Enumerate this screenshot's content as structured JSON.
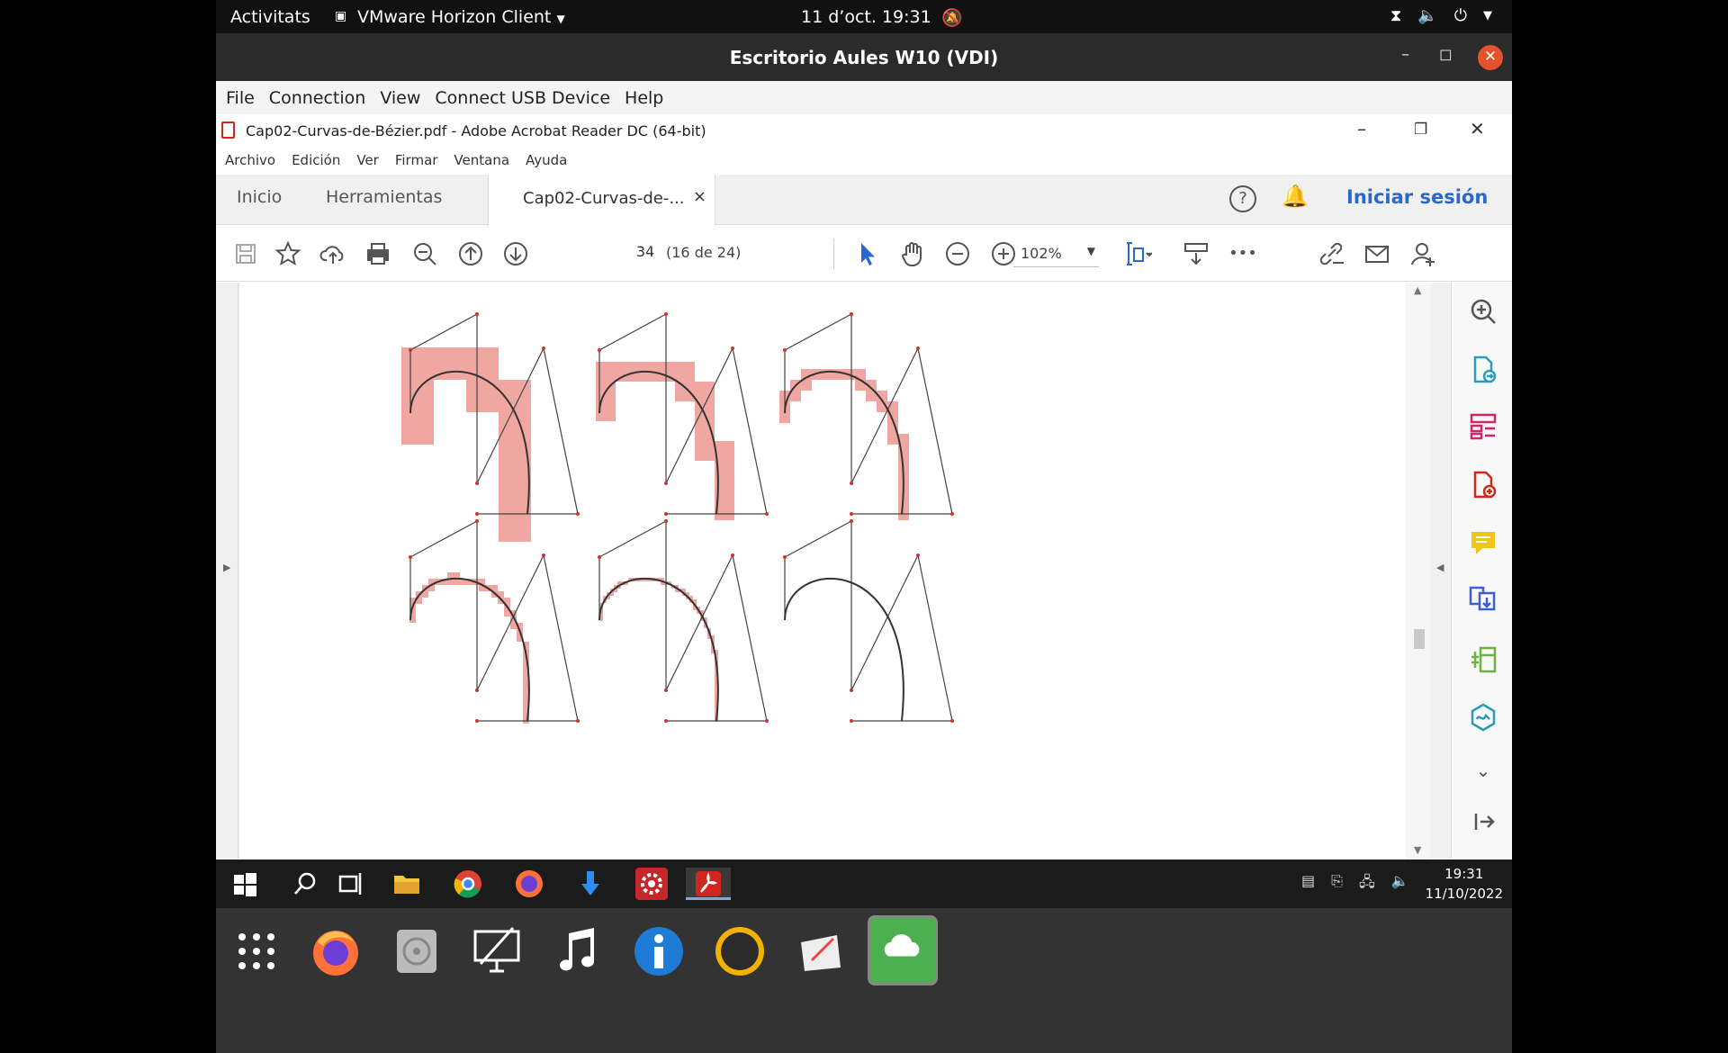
{
  "gnome_bar": {
    "activities": "Activitats",
    "app_name": "VMware Horizon Client",
    "datetime": "11 d’oct.  19:31"
  },
  "vm_window": {
    "title": "Escritorio Aules W10 (VDI)",
    "menu": [
      "File",
      "Connection",
      "View",
      "Connect USB Device",
      "Help"
    ]
  },
  "acrobat": {
    "title": "Cap02-Curvas-de-Bézier.pdf - Adobe Acrobat Reader DC (64-bit)",
    "menu": [
      "Archivo",
      "Edición",
      "Ver",
      "Firmar",
      "Ventana",
      "Ayuda"
    ],
    "tabs": {
      "home": "Inicio",
      "tools": "Herramientas",
      "doc": "Cap02-Curvas-de-...",
      "close": "×"
    },
    "sign_in": "Iniciar sesión",
    "help": "?",
    "page_num": "34",
    "page_of": "(16 de 24)",
    "zoom": "102%",
    "more": "•••"
  },
  "windows_taskbar": {
    "clock_time": "19:31",
    "clock_date": "11/10/2022"
  },
  "colors": {
    "accent_blue": "#2c68c9",
    "acrobat_red": "#d0261d",
    "pixel_fill": "#f0a7a2",
    "curve": "#333333"
  }
}
